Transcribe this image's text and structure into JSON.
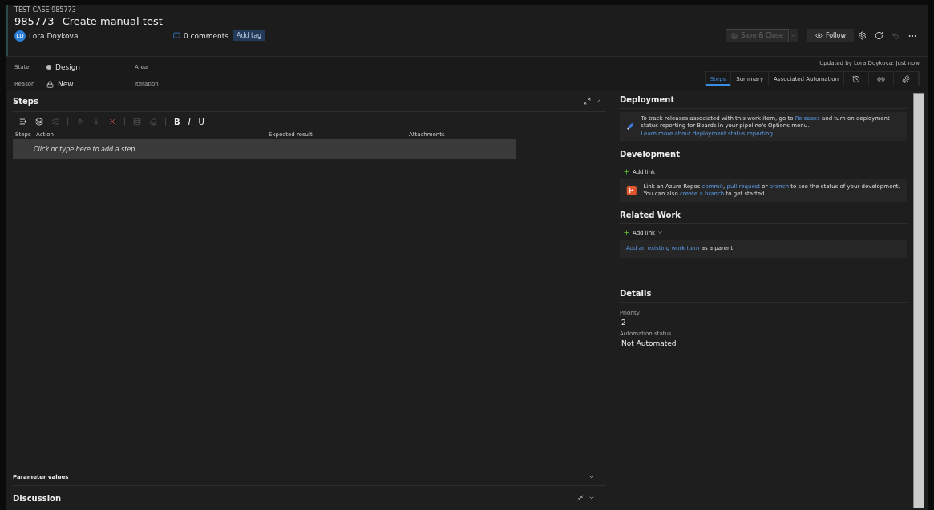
{
  "header": {
    "kind_label": "TEST CASE 985773",
    "id": "985773",
    "title": "Create manual test",
    "assignee": {
      "initials": "LD",
      "name": "Lora Doykova"
    },
    "comments": "0 comments",
    "add_tag": "Add tag"
  },
  "toolbar": {
    "save": {
      "label": "Save & Close",
      "disabled": true
    },
    "follow": "Follow"
  },
  "fields": [
    {
      "kind": "state",
      "label": "State",
      "value": "Design"
    },
    {
      "kind": "reason",
      "label": "Reason",
      "value": "New"
    }
  ],
  "path_fields": [
    "Area",
    "Iteration"
  ],
  "updated": "Updated by Lora Doykova: Just now",
  "tabs": [
    {
      "kind": "text",
      "label": "Steps",
      "selected": true
    },
    {
      "kind": "text",
      "label": "Summary",
      "selected": false
    },
    {
      "kind": "text",
      "label": "Associated Automation",
      "selected": false
    },
    {
      "kind": "history",
      "selected": false
    },
    {
      "kind": "link",
      "selected": false
    },
    {
      "kind": "attachment",
      "selected": false
    }
  ],
  "steps": {
    "title": "Steps",
    "tools": [
      {
        "kind": "insert-step",
        "disabled": false
      },
      {
        "kind": "insert-shared",
        "disabled": false
      },
      {
        "kind": "create-shared",
        "disabled": true
      },
      {
        "kind": "sep"
      },
      {
        "kind": "up",
        "disabled": true
      },
      {
        "kind": "down",
        "disabled": true
      },
      {
        "kind": "delete",
        "disabled": false
      },
      {
        "kind": "sep"
      },
      {
        "kind": "params",
        "disabled": true
      },
      {
        "kind": "clear",
        "disabled": true
      },
      {
        "kind": "sep"
      },
      {
        "kind": "text",
        "label": "B",
        "disabled": false
      },
      {
        "kind": "text",
        "label": "I",
        "disabled": false
      },
      {
        "kind": "text",
        "label": "U",
        "disabled": false
      }
    ],
    "columns": [
      "Steps",
      "Action",
      "Expected result",
      "Attachments"
    ],
    "placeholder": "Click or type here to add a step"
  },
  "parameter_values": "Parameter values",
  "discussion": "Discussion",
  "deployment": {
    "title": "Deployment",
    "message": [
      {
        "text": "To track releases associated with this work item, go to ",
        "link": false
      },
      {
        "text": "Releases",
        "link": true
      },
      {
        "text": " and turn on deployment status reporting for Boards in your pipeline's Options menu. ",
        "link": false
      },
      {
        "text": "Learn more about deployment status reporting",
        "link": true
      }
    ]
  },
  "development": {
    "title": "Development",
    "add_link": "Add link",
    "message": [
      {
        "text": "Link an Azure Repos ",
        "link": false
      },
      {
        "text": "commit",
        "link": true
      },
      {
        "text": ", ",
        "link": false
      },
      {
        "text": "pull request",
        "link": true
      },
      {
        "text": " or ",
        "link": false
      },
      {
        "text": "branch",
        "link": true
      },
      {
        "text": " to see the status of your development. You can also ",
        "link": false
      },
      {
        "text": "create a branch",
        "link": true
      },
      {
        "text": " to get started.",
        "link": false
      }
    ]
  },
  "related_work": {
    "title": "Related Work",
    "add_link": "Add link",
    "message": [
      {
        "text": "Add an existing work item",
        "link": true
      },
      {
        "text": " as a parent",
        "link": false
      }
    ]
  },
  "details": {
    "title": "Details",
    "fields": [
      {
        "label": "Priority",
        "value": "2"
      },
      {
        "label": "Automation status",
        "value": "Not Automated"
      }
    ]
  }
}
